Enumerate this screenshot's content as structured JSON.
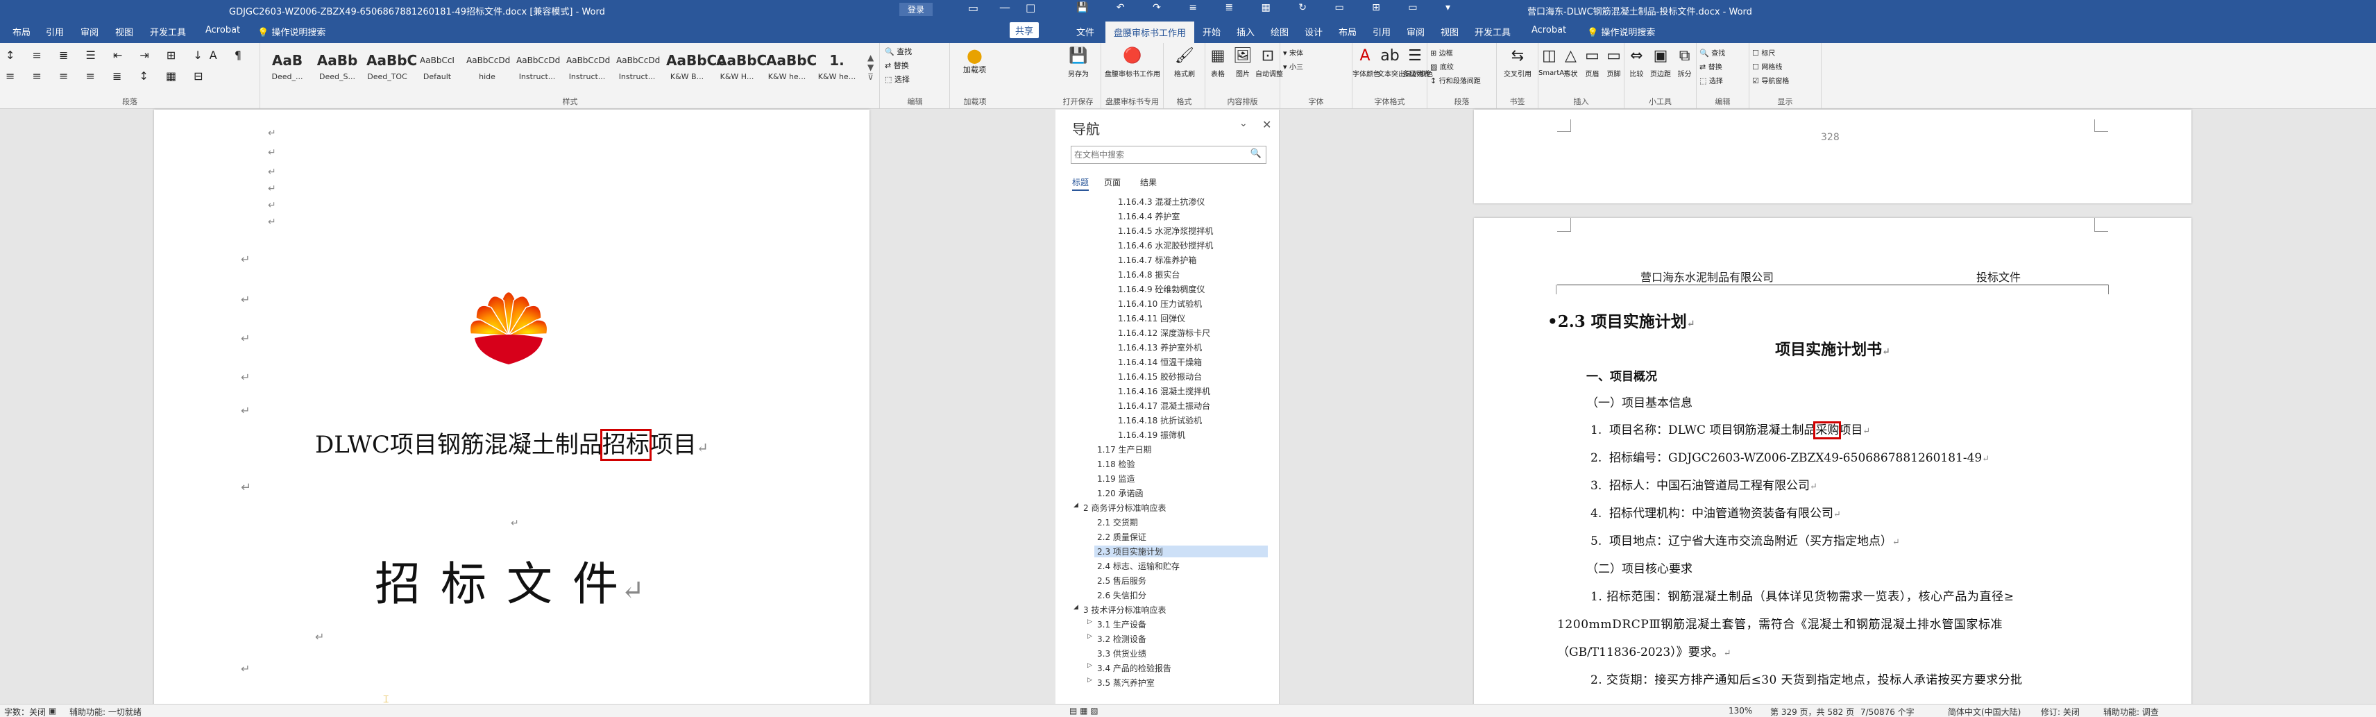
{
  "left_window": {
    "title": "GDJGC2603-WZ006-ZBZX49-6506867881260181-49招标文件.docx [兼容模式] - Word",
    "signin": "登录",
    "share": "共享",
    "tabs": [
      "布局",
      "引用",
      "审阅",
      "视图",
      "开发工具",
      "Acrobat"
    ],
    "tell_me": "操作说明搜索",
    "ribbon": {
      "paragraph_label": "段落",
      "styles_label": "样式",
      "editing_label": "编辑",
      "addin_label": "加载项",
      "styles": [
        {
          "preview": "AaB",
          "name": "Deed_..."
        },
        {
          "preview": "AaBb",
          "name": "Deed_S..."
        },
        {
          "preview": "AaBbC",
          "name": "Deed_TOC"
        },
        {
          "preview": "AaBbCcI",
          "name": "Default"
        },
        {
          "preview": "AaBbCcDd",
          "name": "hide"
        },
        {
          "preview": "AaBbCcDd",
          "name": "Instruct..."
        },
        {
          "preview": "AaBbCcDd",
          "name": "Instruct..."
        },
        {
          "preview": "AaBbCcDd",
          "name": "Instruct..."
        },
        {
          "preview": "AaBbCc",
          "name": "K&W B..."
        },
        {
          "preview": "AaBbC",
          "name": "K&W H..."
        },
        {
          "preview": "AaBbC",
          "name": "K&W he..."
        },
        {
          "preview": "1.",
          "name": "K&W he..."
        }
      ],
      "find": "查找",
      "replace": "替换",
      "select": "选择",
      "addin": "加载项"
    },
    "document": {
      "project_title_before": "DLWC项目钢筋混凝土制品",
      "project_title_highlight": "招标",
      "project_title_after": "项目",
      "doc_title": "招 标 文 件"
    },
    "status": {
      "word_count": "字数：关闭",
      "accessibility": "辅助功能: 一切就绪"
    }
  },
  "right_window": {
    "title": "营口海东-DLWC钢筋混凝土制品-投标文件.docx - Word",
    "tabs": [
      "文件",
      "盘腰审标书工作用",
      "开始",
      "插入",
      "绘图",
      "设计",
      "布局",
      "引用",
      "审阅",
      "视图",
      "开发工具",
      "Acrobat"
    ],
    "tell_me": "操作说明搜索",
    "ribbon": {
      "groups": [
        {
          "label": "打开保存",
          "buttons": [
            "另存为"
          ]
        },
        {
          "label": "盘腰审标书专用",
          "buttons": [
            "盘腰审标书工作用"
          ]
        },
        {
          "label": "格式",
          "buttons": [
            "格式刷"
          ]
        },
        {
          "label": "内容排版",
          "buttons": [
            "表格",
            "图片",
            "自动调整"
          ]
        },
        {
          "label": "字体",
          "buttons": [
            "宋体",
            "小三"
          ]
        },
        {
          "label": "字体格式",
          "buttons": [
            "字体颜色",
            "文本突出显示颜色",
            "多级列表"
          ]
        },
        {
          "label": "段落",
          "buttons": [
            "边框",
            "底纹",
            "行和段落间距"
          ]
        },
        {
          "label": "书签",
          "buttons": [
            "交叉引用"
          ]
        },
        {
          "label": "插入",
          "buttons": [
            "SmartArt",
            "形状",
            "页眉",
            "页脚"
          ]
        },
        {
          "label": "小工具",
          "buttons": [
            "比较",
            "页边距",
            "拆分"
          ]
        },
        {
          "label": "编辑",
          "buttons": [
            "查找",
            "替换",
            "选择"
          ]
        },
        {
          "label": "显示",
          "buttons": [
            "标尺",
            "网格线",
            "导航窗格"
          ]
        }
      ]
    },
    "navigation": {
      "title": "导航",
      "search_placeholder": "在文档中搜索",
      "tabs": [
        "标题",
        "页面",
        "结果"
      ],
      "items": [
        "1.16.4.3 混凝土抗渗仪",
        "1.16.4.4 养护室",
        "1.16.4.5 水泥净浆搅拌机",
        "1.16.4.6 水泥胶砂搅拌机",
        "1.16.4.7 标准养护箱",
        "1.16.4.8 振实台",
        "1.16.4.9 砼维勃稠度仪",
        "1.16.4.10 压力试验机",
        "1.16.4.11 回弹仪",
        "1.16.4.12 深度游标卡尺",
        "1.16.4.13 养护室外机",
        "1.16.4.14 恒温干燥箱",
        "1.16.4.15 胶砂振动台",
        "1.16.4.16 混凝土搅拌机",
        "1.16.4.17 混凝土振动台",
        "1.16.4.18 抗折试验机",
        "1.16.4.19 振筛机",
        "1.17 生产日期",
        "1.18 检验",
        "1.19 监造",
        "1.20 承诺函",
        "2 商务评分标准响应表",
        "2.1 交货期",
        "2.2 质量保证",
        "2.3 项目实施计划",
        "2.4 标志、运输和贮存",
        "2.5 售后服务",
        "2.6 失信扣分",
        "3 技术评分标准响应表",
        "3.1 生产设备",
        "3.2 检测设备",
        "3.3 供货业绩",
        "3.4 产品的检验报告",
        "3.5 蒸汽养护室"
      ],
      "selected": "2.3 项目实施计划"
    },
    "document": {
      "page_number": "328",
      "header_left": "营口海东水泥制品有限公司",
      "header_right": "投标文件",
      "section_heading": "2.3 项目实施计划",
      "doc_title": "项目实施计划书",
      "h1": "一、项目概况",
      "h2": "（一）项目基本信息",
      "items": [
        {
          "num": "1.",
          "label": "项目名称：",
          "before": "DLWC 项目钢筋混凝土制品",
          "highlight": "采购",
          "after": "项目"
        },
        {
          "num": "2.",
          "label": "招标编号：",
          "text": "GDJGC2603-WZ006-ZBZX49-6506867881260181-49"
        },
        {
          "num": "3.",
          "label": "招标人：",
          "text": "中国石油管道局工程有限公司"
        },
        {
          "num": "4.",
          "label": "招标代理机构：",
          "text": "中油管道物资装备有限公司"
        },
        {
          "num": "5.",
          "label": "项目地点：",
          "text": "辽宁省大连市交流岛附近（买方指定地点）"
        }
      ],
      "h2b": "（二）项目核心要求",
      "core_1_line1": "1.  招标范围：钢筋混凝土制品（具体详见货物需求一览表），核心产品为直径≥",
      "core_1_line2": "1200mmDRCPⅢ钢筋混凝土套管，需符合《混凝土和钢筋混凝土排水管国家标准",
      "core_1_line3": "（GB/T11836-2023）》要求。",
      "core_2": "2.  交货期：接买方排产通知后≤30 天货到指定地点，投标人承诺按买方要求分批"
    },
    "status": {
      "zoom": "130%",
      "words": "第 329 页，共 582 页",
      "chars": "7/50876 个字",
      "lang": "简体中文(中国大陆)",
      "mode": "修订: 关闭",
      "access": "辅助功能: 调查"
    }
  },
  "colors": {
    "ribbon_blue": "#2b579a",
    "highlight_red": "#d00000",
    "selected_nav": "#cde0f7"
  }
}
